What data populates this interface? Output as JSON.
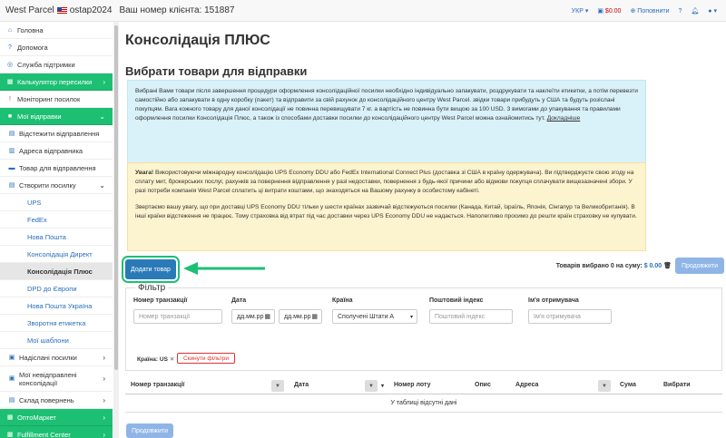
{
  "topbar": {
    "brand": "West Parcel",
    "username": "ostap2024",
    "client_label": "Ваш номер клієнта: 151887",
    "language": "УКР",
    "balance": "$0.00",
    "add_funds": "Поповнити"
  },
  "sidebar": {
    "home": "Головна",
    "help": "Допомога",
    "support": "Служба підтримки",
    "calculator": "Калькулятор пересилки",
    "monitoring": "Моніторинг посилок",
    "my_shipments": "Мої відправки",
    "tracking": "Відстежити відправлення",
    "address": "Адреса відправника",
    "goods": "Товар для відправлення",
    "create": "Створити посилку",
    "ups": "UPS",
    "fedex": "FedEx",
    "novaposhta": "Нова Пошта",
    "consolidation_direct": "Консолідація Директ",
    "consolidation_plus": "Консолідація Плюс",
    "dpd": "DPD до Європи",
    "novaposhta_ua": "Нова Пошта Україна",
    "return_label": "Зворотня етикетка",
    "templates": "Мої шаблони",
    "sent": "Надіслані посилки",
    "unsent_line1": "Мої невідправлені",
    "unsent_line2": "консолідації",
    "warehouse": "Склад повернень",
    "optomarket": "ОптоМаркет",
    "fulfillment": "Fulfillment Center"
  },
  "main": {
    "title": "Консолідація ПЛЮС",
    "section": "Вибрати товари для відправки",
    "info_text": "Вибрані Вами товари після завершення процедури оформлення консолідаційної посилки необхідно індивідуально запакувати, роздрукувати та наклеїти етикетки, а потім перевезти самостійно або запакувати в одну коробку (пакет) та відправити за свій рахунок до консолідаційного центру West Parcel. звідки товари прибудуть у США та будуть розіслані покупцям. Вага кожного товару для даної консолідації не повинна перевищувати 7 кг. а вартість не повинна бути вищою за 100 USD. З вимогами до упакування та правилами оформлення посилки Консолідація Плюс, а також із способами доставки посилки до консолідаційного центру West Parcel можна ознайомитись тут.",
    "info_link": "Докладніше",
    "warn_strong": "Увага!",
    "warn_text": "Використовуючи міжнародну консолідацію UPS Economy DDU або FedEx International Connect Plus (доставка зі США в країну одержувача). Ви підтверджуєте свою згоду на сплату мит, брокерських послуг, рахунків за повернення відправлення у разі недоставки, повернення з будь-якої причини або відмови покупця сплачувати вищезазначені збори. У разі потреби компанія West Parcel сплатить ці витрати коштами, що знаходяться на Вашому рахунку в особистому кабінеті.",
    "warn_text2": "Звертаємо вашу увагу, що при доставці UPS Economy DDU тільки у шести країнах зазвичай відстежуються посилки (Канада, Китай, Ізраїль, Японія, Сінгапур та Великобританія). В інші країни відстеження не працює. Тому страховка від втрат під час доставки через UPS Economy DDU не надається. Наполегливо просимо до решти країн страховку не купувати.",
    "add_button": "Додати товар",
    "selected_prefix": "Товарів вибрано 0 на суму:",
    "selected_sum": "$ 0.00",
    "continue": "Продовжити"
  },
  "filter": {
    "legend": "Фільтр",
    "transaction_label": "Номер транзакції",
    "transaction_placeholder": "Номер транзакції",
    "date_label": "Дата",
    "date_from": "дд.мм.рр",
    "date_to": "дд.мм.рр",
    "country_label": "Країна",
    "country_value": "Сполучені Штати А",
    "zip_label": "Поштовий індекс",
    "zip_placeholder": "Поштовий індекс",
    "recipient_label": "Ім'я отримувача",
    "recipient_placeholder": "Ім'я отримувача",
    "chip": "Країна: US",
    "reset": "Скинути фільтри"
  },
  "table": {
    "headers": [
      "Номер транзакції",
      "Дата",
      "Номер лоту",
      "Опис",
      "Адреса",
      "Сума",
      "Вибрати"
    ],
    "empty": "У таблиці відсутні дані"
  },
  "colors": {
    "green": "#1dbf73",
    "blue": "#2a7ab8",
    "info_bg": "#d9f1f8",
    "warn_bg": "#fcf3cf"
  }
}
